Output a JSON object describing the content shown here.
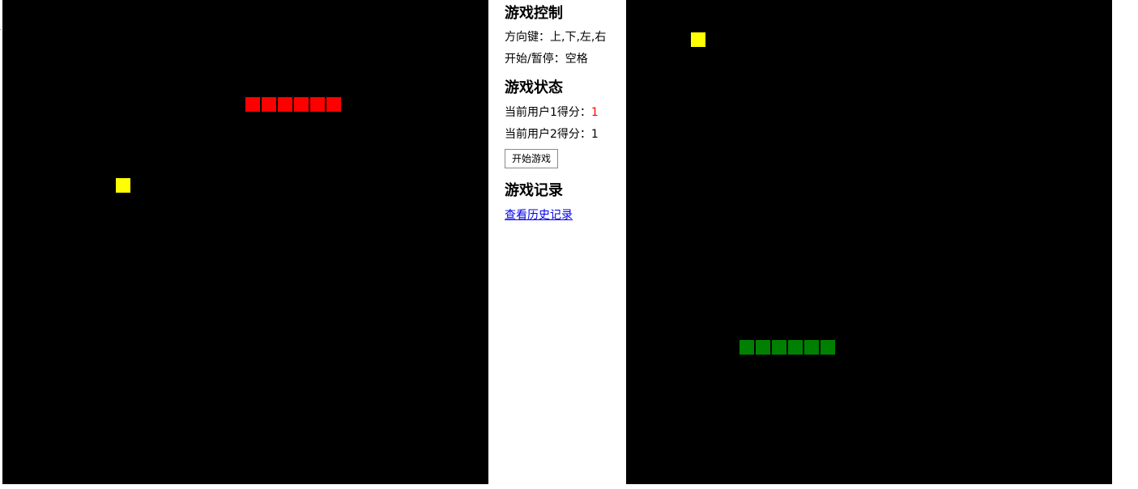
{
  "panel": {
    "controls_heading": "游戏控制",
    "keys_line": "方向键：上,下,左,右",
    "pause_line": "开始/暂停：空格",
    "status_heading": "游戏状态",
    "score1_label": "当前用户1得分：",
    "score1_value": "1",
    "score2_label": "当前用户2得分：",
    "score2_value": "1",
    "start_button": "开始游戏",
    "records_heading": "游戏记录",
    "history_link": "查看历史记录"
  },
  "colors": {
    "board_background": "#000000",
    "food": "#ffff00",
    "player1_snake": "#ff0000",
    "player2_snake": "#008000",
    "score1_highlight": "#ff0000",
    "link": "#0000ee"
  },
  "game": {
    "grid_cell": 20,
    "left_board": {
      "snake": {
        "color": "red",
        "cells": [
          [
            15,
            6
          ],
          [
            16,
            6
          ],
          [
            17,
            6
          ],
          [
            18,
            6
          ],
          [
            19,
            6
          ],
          [
            20,
            6
          ]
        ]
      },
      "food": [
        7,
        11
      ]
    },
    "right_board": {
      "snake": {
        "color": "green",
        "cells": [
          [
            7,
            21
          ],
          [
            8,
            21
          ],
          [
            9,
            21
          ],
          [
            10,
            21
          ],
          [
            11,
            21
          ],
          [
            12,
            21
          ]
        ]
      },
      "food": [
        4,
        2
      ]
    }
  }
}
